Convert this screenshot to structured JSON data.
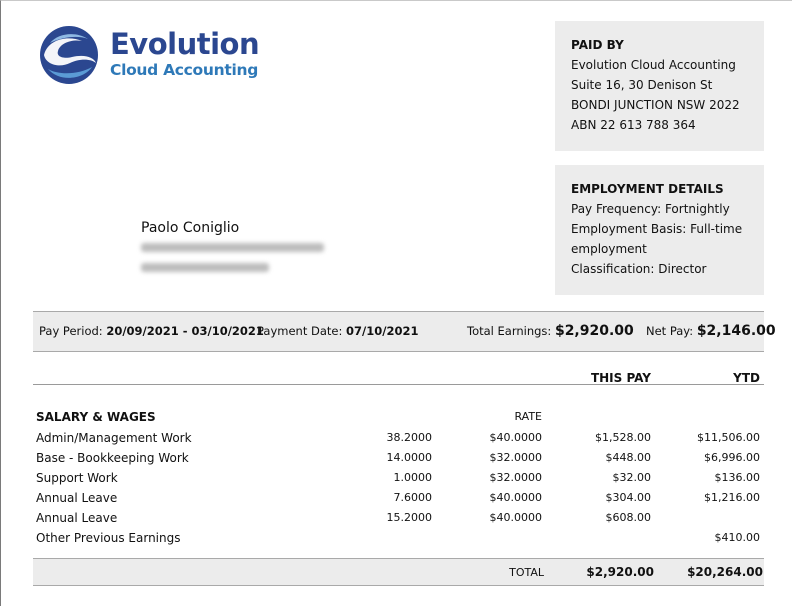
{
  "logo": {
    "title": "Evolution",
    "subtitle": "Cloud Accounting"
  },
  "paid_by": {
    "heading": "PAID BY",
    "lines": [
      "Evolution Cloud Accounting",
      "Suite 16, 30 Denison St",
      "BONDI JUNCTION NSW 2022",
      "ABN 22 613 788 364"
    ]
  },
  "employment": {
    "heading": "EMPLOYMENT DETAILS",
    "lines": [
      "Pay Frequency: Fortnightly",
      "Employment Basis: Full-time",
      "employment",
      "Classification: Director"
    ]
  },
  "employee": {
    "name": "Paolo Coniglio"
  },
  "summary": {
    "pay_period_label": "Pay Period:",
    "pay_period_value": "20/09/2021 - 03/10/2021",
    "payment_date_label": "Payment Date:",
    "payment_date_value": "07/10/2021",
    "total_earnings_label": "Total Earnings:",
    "total_earnings_value": "$2,920.00",
    "net_pay_label": "Net Pay:",
    "net_pay_value": "$2,146.00"
  },
  "table": {
    "this_pay_header": "THIS PAY",
    "ytd_header": "YTD",
    "section_title": "SALARY & WAGES",
    "rate_header": "RATE",
    "rows": [
      {
        "label": "Admin/Management Work",
        "units": "38.2000",
        "rate": "$40.0000",
        "this_pay": "$1,528.00",
        "ytd": "$11,506.00"
      },
      {
        "label": "Base - Bookkeeping Work",
        "units": "14.0000",
        "rate": "$32.0000",
        "this_pay": "$448.00",
        "ytd": "$6,996.00"
      },
      {
        "label": "Support Work",
        "units": "1.0000",
        "rate": "$32.0000",
        "this_pay": "$32.00",
        "ytd": "$136.00"
      },
      {
        "label": "Annual Leave",
        "units": "7.6000",
        "rate": "$40.0000",
        "this_pay": "$304.00",
        "ytd": "$1,216.00"
      },
      {
        "label": "Annual Leave",
        "units": "15.2000",
        "rate": "$40.0000",
        "this_pay": "$608.00",
        "ytd": ""
      },
      {
        "label": "Other Previous Earnings",
        "units": "",
        "rate": "",
        "this_pay": "",
        "ytd": "$410.00"
      }
    ],
    "total_label": "TOTAL",
    "total_this_pay": "$2,920.00",
    "total_ytd": "$20,264.00"
  },
  "colors": {
    "brand_dark": "#2b4790",
    "brand_light": "#2e79b8",
    "panel_bg": "#ececec"
  }
}
